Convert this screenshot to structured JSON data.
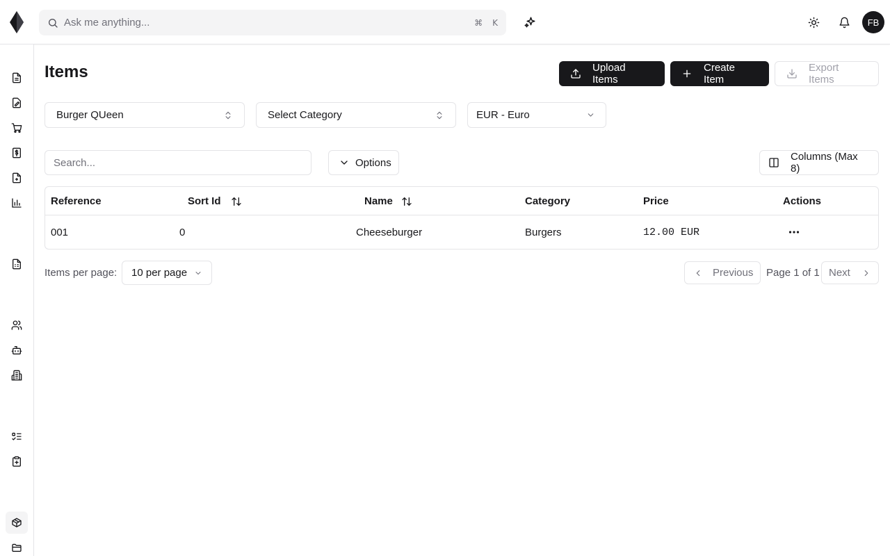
{
  "header": {
    "search_placeholder": "Ask me anything...",
    "shortcut_cmd": "⌘",
    "shortcut_key": "K",
    "avatar_initials": "FB"
  },
  "page": {
    "title": "Items",
    "upload_label": "Upload Items",
    "create_label": "Create Item",
    "export_label": "Export Items"
  },
  "filters": {
    "restaurant": "Burger QUeen",
    "category": "Select Category",
    "currency": "EUR - Euro",
    "search_placeholder": "Search...",
    "options_label": "Options",
    "columns_label": "Columns (Max 8)"
  },
  "table": {
    "headers": {
      "reference": "Reference",
      "sort_id": "Sort Id",
      "name": "Name",
      "category": "Category",
      "price": "Price",
      "actions": "Actions"
    },
    "rows": [
      {
        "reference": "001",
        "sort_id": "0",
        "name": "Cheeseburger",
        "category": "Burgers",
        "price": "12.00 EUR"
      }
    ]
  },
  "pagination": {
    "items_per_page_label": "Items per page:",
    "per_page_value": "10 per page",
    "previous_label": "Previous",
    "page_info": "Page 1 of 1",
    "next_label": "Next"
  },
  "sidebar": {
    "items": [
      {
        "icon": "document-icon"
      },
      {
        "icon": "signature-icon"
      },
      {
        "icon": "cart-icon"
      },
      {
        "icon": "invoice-icon"
      },
      {
        "icon": "receipt-icon"
      },
      {
        "icon": "chart-icon"
      },
      {
        "icon": "spreadsheet-icon"
      },
      {
        "icon": "users-icon"
      },
      {
        "icon": "bot-icon"
      },
      {
        "icon": "building-icon"
      },
      {
        "icon": "checklist-icon"
      },
      {
        "icon": "clipboard-icon"
      },
      {
        "icon": "package-icon"
      },
      {
        "icon": "folder-icon"
      }
    ]
  }
}
